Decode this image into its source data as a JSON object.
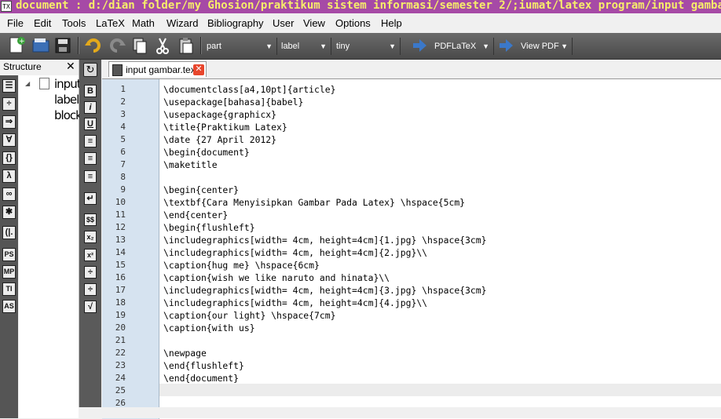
{
  "window": {
    "title": "document : d:/dian folder/my Ghosion/praktikum sistem informasi/semester 2/;iumat/latex program/input gambar.tex"
  },
  "menu": [
    "File",
    "Edit",
    "Tools",
    "LaTeX",
    "Math",
    "Wizard",
    "Bibliography",
    "User",
    "View",
    "Options",
    "Help"
  ],
  "toolbar": {
    "combos": [
      {
        "value": "part"
      },
      {
        "value": "label"
      },
      {
        "value": "tiny"
      },
      {
        "value": "PDFLaTeX"
      },
      {
        "value": "View PDF"
      }
    ]
  },
  "structure": {
    "header": "Structure",
    "close": "✕",
    "nodes": [
      "input",
      "label",
      "block"
    ],
    "side_icons": [
      "section-icon",
      "division-icon",
      "arrow-right-icon",
      "forall-icon",
      "braces-icon",
      "lambda-icon",
      "infinity-icon",
      "asterisk-icon",
      "left-right-icon",
      "ps-icon",
      "mp-icon",
      "ti-icon",
      "as-icon"
    ],
    "side_labels": [
      "☰",
      "÷",
      "⇒",
      "∀",
      "{}",
      "λ",
      "∞",
      "✱",
      "(|.",
      "PS",
      "MP",
      "TI",
      "AS"
    ]
  },
  "left_toolbar": {
    "icons": [
      "refresh-icon",
      "bold-icon",
      "italic-icon",
      "underline-icon",
      "align-left-icon",
      "align-center-icon",
      "align-right-icon",
      "new-line-icon",
      "math-mode-icon",
      "subscript-icon",
      "superscript-icon",
      "fraction-icon",
      "dfrac-icon",
      "sqrt-icon"
    ],
    "labels": [
      "↻",
      "B",
      "i",
      "U",
      "≡",
      "≡",
      "≡",
      "↵",
      "$$",
      "x₂",
      "x²",
      "÷",
      "÷",
      "√"
    ]
  },
  "editor": {
    "tab_label": "input gambar.tex",
    "tab_close": "✕",
    "line_numbers": [
      "1",
      "2",
      "3",
      "4",
      "5",
      "6",
      "7",
      "8",
      "9",
      "10",
      "11",
      "12",
      "13",
      "14",
      "15",
      "16",
      "17",
      "18",
      "19",
      "20",
      "21",
      "22",
      "23",
      "24",
      "25",
      "26"
    ],
    "lines": [
      "\\documentclass[a4,10pt]{article}",
      "\\usepackage[bahasa]{babel}",
      "\\usepackage{graphicx}",
      "\\title{Praktikum Latex}",
      "\\date {27 April 2012}",
      "\\begin{document}",
      "\\maketitle",
      "",
      "\\begin{center}",
      "\\textbf{Cara Menyisipkan Gambar Pada Latex} \\hspace{5cm}",
      "\\end{center}",
      "\\begin{flushleft}",
      "\\includegraphics[width= 4cm, height=4cm]{1.jpg} \\hspace{3cm}",
      "\\includegraphics[width= 4cm, height=4cm]{2.jpg}\\\\",
      "\\caption{hug me} \\hspace{6cm}",
      "\\caption{wish we like naruto and hinata}\\\\",
      "\\includegraphics[width= 4cm, height=4cm]{3.jpg} \\hspace{3cm}",
      "\\includegraphics[width= 4cm, height=4cm]{4.jpg}\\\\",
      "\\caption{our light} \\hspace{7cm}",
      "\\caption{with us}",
      "",
      "\\newpage",
      "\\end{flushleft}",
      "\\end{document}",
      "",
      ""
    ]
  }
}
